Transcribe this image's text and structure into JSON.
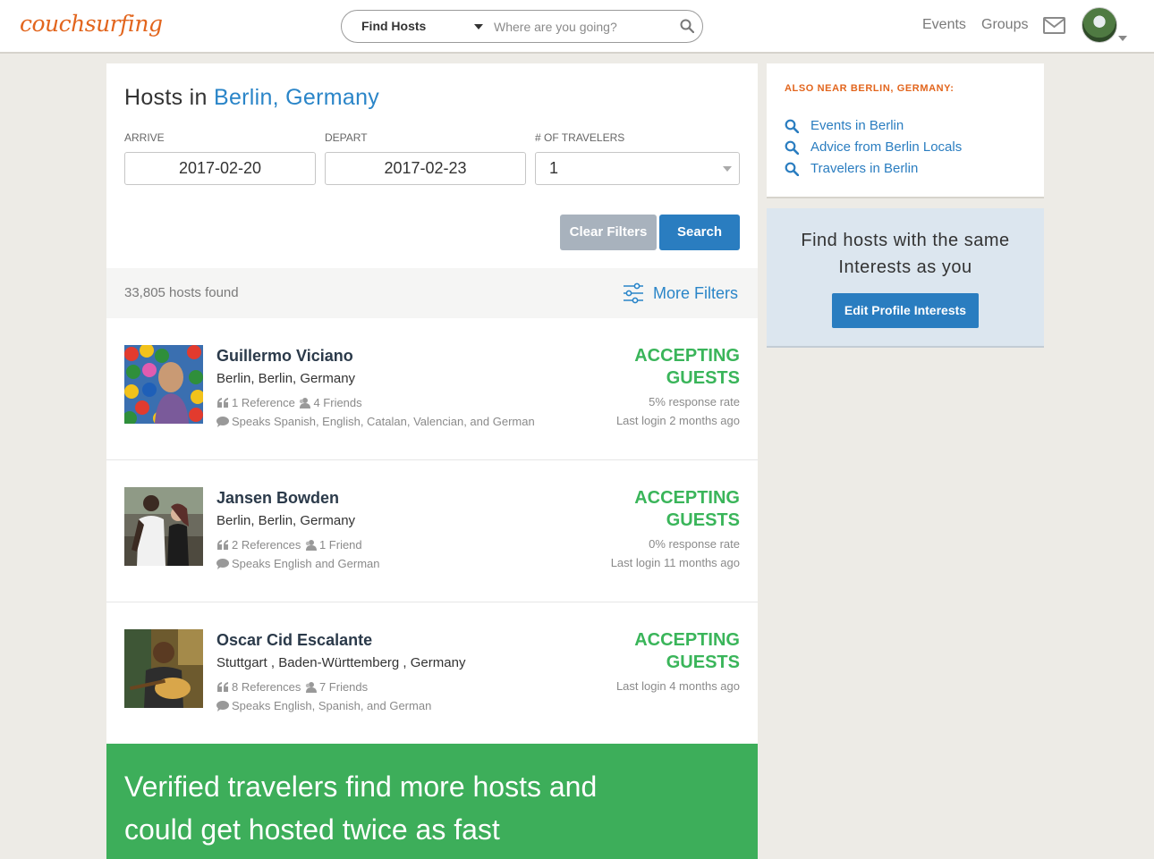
{
  "header": {
    "logo": "couchsurfing",
    "search_mode": "Find Hosts",
    "search_placeholder": "Where are you going?",
    "nav": [
      "Events",
      "Groups"
    ]
  },
  "search_panel": {
    "title_prefix": "Hosts in",
    "title_location": "Berlin, Germany",
    "arrive_label": "ARRIVE",
    "arrive_value": "2017-02-20",
    "depart_label": "DEPART",
    "depart_value": "2017-02-23",
    "travelers_label": "# OF TRAVELERS",
    "travelers_value": "1",
    "clear_label": "Clear Filters",
    "search_label": "Search"
  },
  "results": {
    "count_text": "33,805 hosts found",
    "more_filters": "More Filters"
  },
  "hosts": [
    {
      "name": "Guillermo Viciano",
      "location": "Berlin, Berlin, Germany",
      "references": "1 Reference",
      "friends": "4 Friends",
      "languages": "Speaks Spanish, English, Catalan, Valencian, and German",
      "status_line1": "ACCEPTING",
      "status_line2": "GUESTS",
      "response_rate": "5% response rate",
      "last_login": "Last login 2 months ago"
    },
    {
      "name": "Jansen Bowden",
      "location": "Berlin, Berlin, Germany",
      "references": "2 References",
      "friends": "1 Friend",
      "languages": "Speaks English and German",
      "status_line1": "ACCEPTING",
      "status_line2": "GUESTS",
      "response_rate": "0% response rate",
      "last_login": "Last login 11 months ago"
    },
    {
      "name": "Oscar Cid Escalante",
      "location": "Stuttgart , Baden-Württemberg , Germany",
      "references": "8 References",
      "friends": "7 Friends",
      "languages": "Speaks English, Spanish, and German",
      "status_line1": "ACCEPTING",
      "status_line2": "GUESTS",
      "response_rate": "",
      "last_login": "Last login 4 months ago"
    }
  ],
  "verify_banner": {
    "line1": "Verified travelers find more hosts and",
    "line2": "could get hosted twice as fast"
  },
  "sidebar": {
    "near_title": "ALSO NEAR BERLIN, GERMANY:",
    "near_links": [
      "Events in Berlin",
      "Advice from Berlin Locals",
      "Travelers in Berlin"
    ],
    "interests_line1": "Find hosts with the same",
    "interests_line2": "Interests as you",
    "interests_button": "Edit Profile Interests"
  },
  "colors": {
    "brand_orange": "#e2651d",
    "link_blue": "#2a85c8",
    "button_blue": "#2a7dc0",
    "accepting_green": "#3ab55a",
    "verify_green": "#3dae5a"
  }
}
